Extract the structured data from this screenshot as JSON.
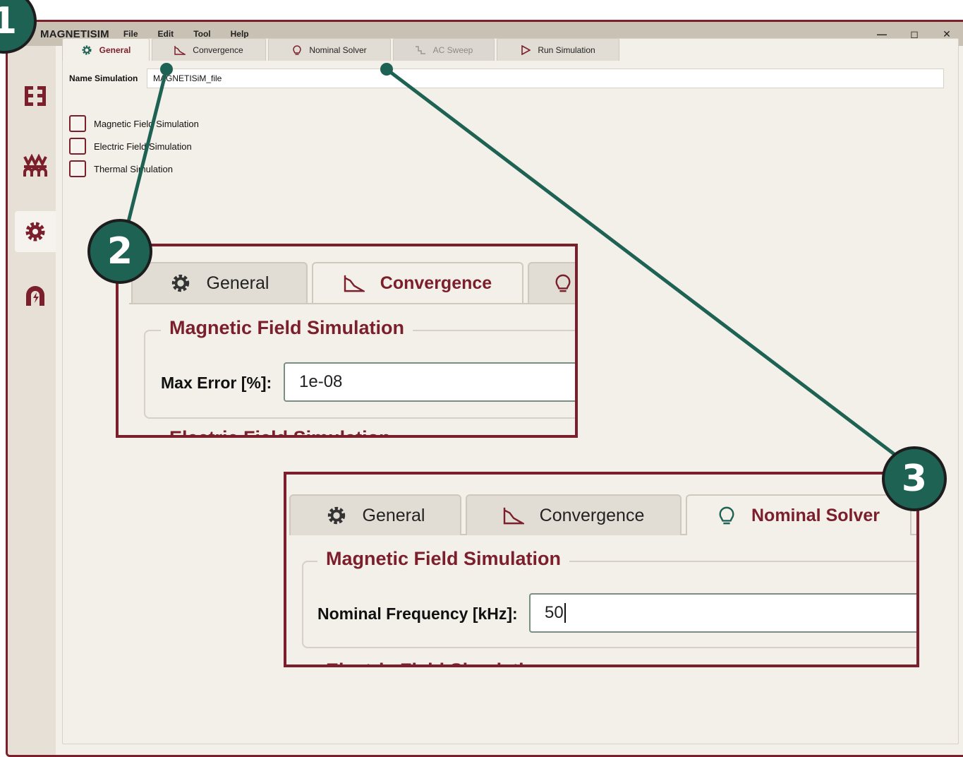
{
  "app": {
    "title": "MAGNETISIM"
  },
  "menu": [
    "File",
    "Edit",
    "Tool",
    "Help"
  ],
  "window_controls": {
    "minimize": "—",
    "maximize": "◻",
    "close": "✕"
  },
  "sidebar": {
    "items": [
      {
        "icon": "core-icon"
      },
      {
        "icon": "coil-icon"
      },
      {
        "icon": "settings-icon",
        "active": true
      },
      {
        "icon": "magnet-icon"
      }
    ]
  },
  "tabs": [
    {
      "label": "General",
      "icon": "gear-icon",
      "active": true
    },
    {
      "label": "Convergence",
      "icon": "chart-icon"
    },
    {
      "label": "Nominal Solver",
      "icon": "bulb-icon"
    },
    {
      "label": "AC Sweep",
      "icon": "sweep-icon",
      "disabled": true
    },
    {
      "label": "Run Simulation",
      "icon": "play-icon"
    }
  ],
  "general": {
    "name_label": "Name Simulation",
    "name_value": "MAGNETISiM_file",
    "checks": [
      "Magnetic Field Simulation",
      "Electric Field Simulation",
      "Thermal Simulation"
    ]
  },
  "callout2": {
    "tabs": [
      "General",
      "Convergence"
    ],
    "group_title": "Magnetic Field Simulation",
    "field_label": "Max Error [%]:",
    "field_value": "1e-08",
    "next_group": "Electric Field Simulation"
  },
  "callout3": {
    "tabs": [
      "General",
      "Convergence",
      "Nominal Solver"
    ],
    "group_title": "Magnetic Field Simulation",
    "field_label": "Nominal Frequency [kHz]:",
    "field_value": "50",
    "next_group": "Electric Field Simulation"
  },
  "badges": [
    "1",
    "2",
    "3"
  ],
  "colors": {
    "accent": "#7a1f2b",
    "badge": "#1e6254",
    "titlebar": "#c9c1b3",
    "background": "#f3efe9"
  }
}
